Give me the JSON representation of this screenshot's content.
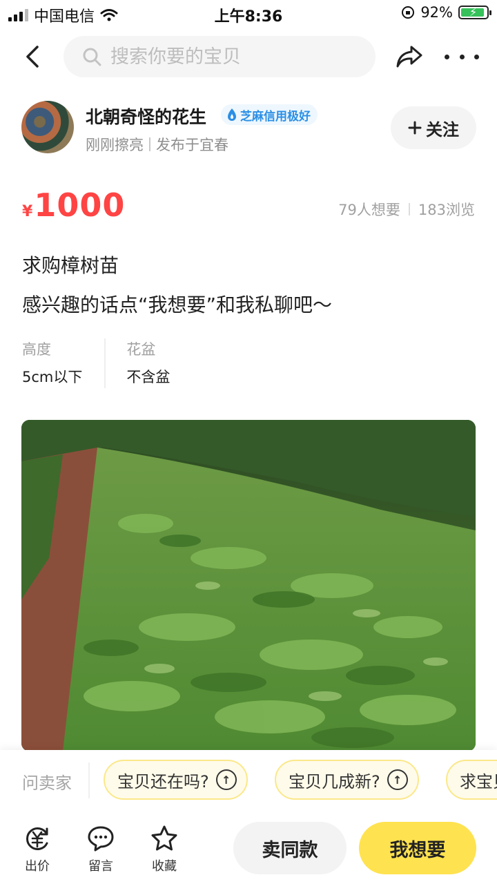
{
  "status_bar": {
    "carrier": "中国电信",
    "time": "上午8:36",
    "battery_percent": "92%",
    "battery_level": 0.92
  },
  "nav": {
    "search_placeholder": "搜索你要的宝贝",
    "icons": [
      "chevron-left-icon",
      "search-icon",
      "share-icon",
      "more-icon"
    ]
  },
  "seller": {
    "name": "北朝奇怪的花生",
    "credit_badge": "芝麻信用极好",
    "last_active": "刚刚擦亮",
    "location": "发布于宜春",
    "follow_label": "关注"
  },
  "item": {
    "currency": "¥",
    "price": "1000",
    "wants": "79人想要",
    "views": "183浏览",
    "title": "求购樟树苗",
    "description": "感兴趣的话点“我想要”和我私聊吧～",
    "attributes": [
      {
        "label": "高度",
        "value": "5cm以下"
      },
      {
        "label": "花盆",
        "value": "不含盆"
      }
    ]
  },
  "quick_questions": {
    "label": "问卖家",
    "chips": [
      "宝贝还在吗?",
      "宝贝几成新?",
      "求宝贝"
    ]
  },
  "bottom_bar": {
    "tabs": [
      {
        "label": "出价",
        "icon": "bid-yen-icon"
      },
      {
        "label": "留言",
        "icon": "comment-icon"
      },
      {
        "label": "收藏",
        "icon": "star-icon"
      }
    ],
    "same_label": "卖同款",
    "want_label": "我想要"
  },
  "colors": {
    "price": "#ff4444",
    "want_button": "#ffe24f",
    "credit": "#2b8fe5"
  }
}
